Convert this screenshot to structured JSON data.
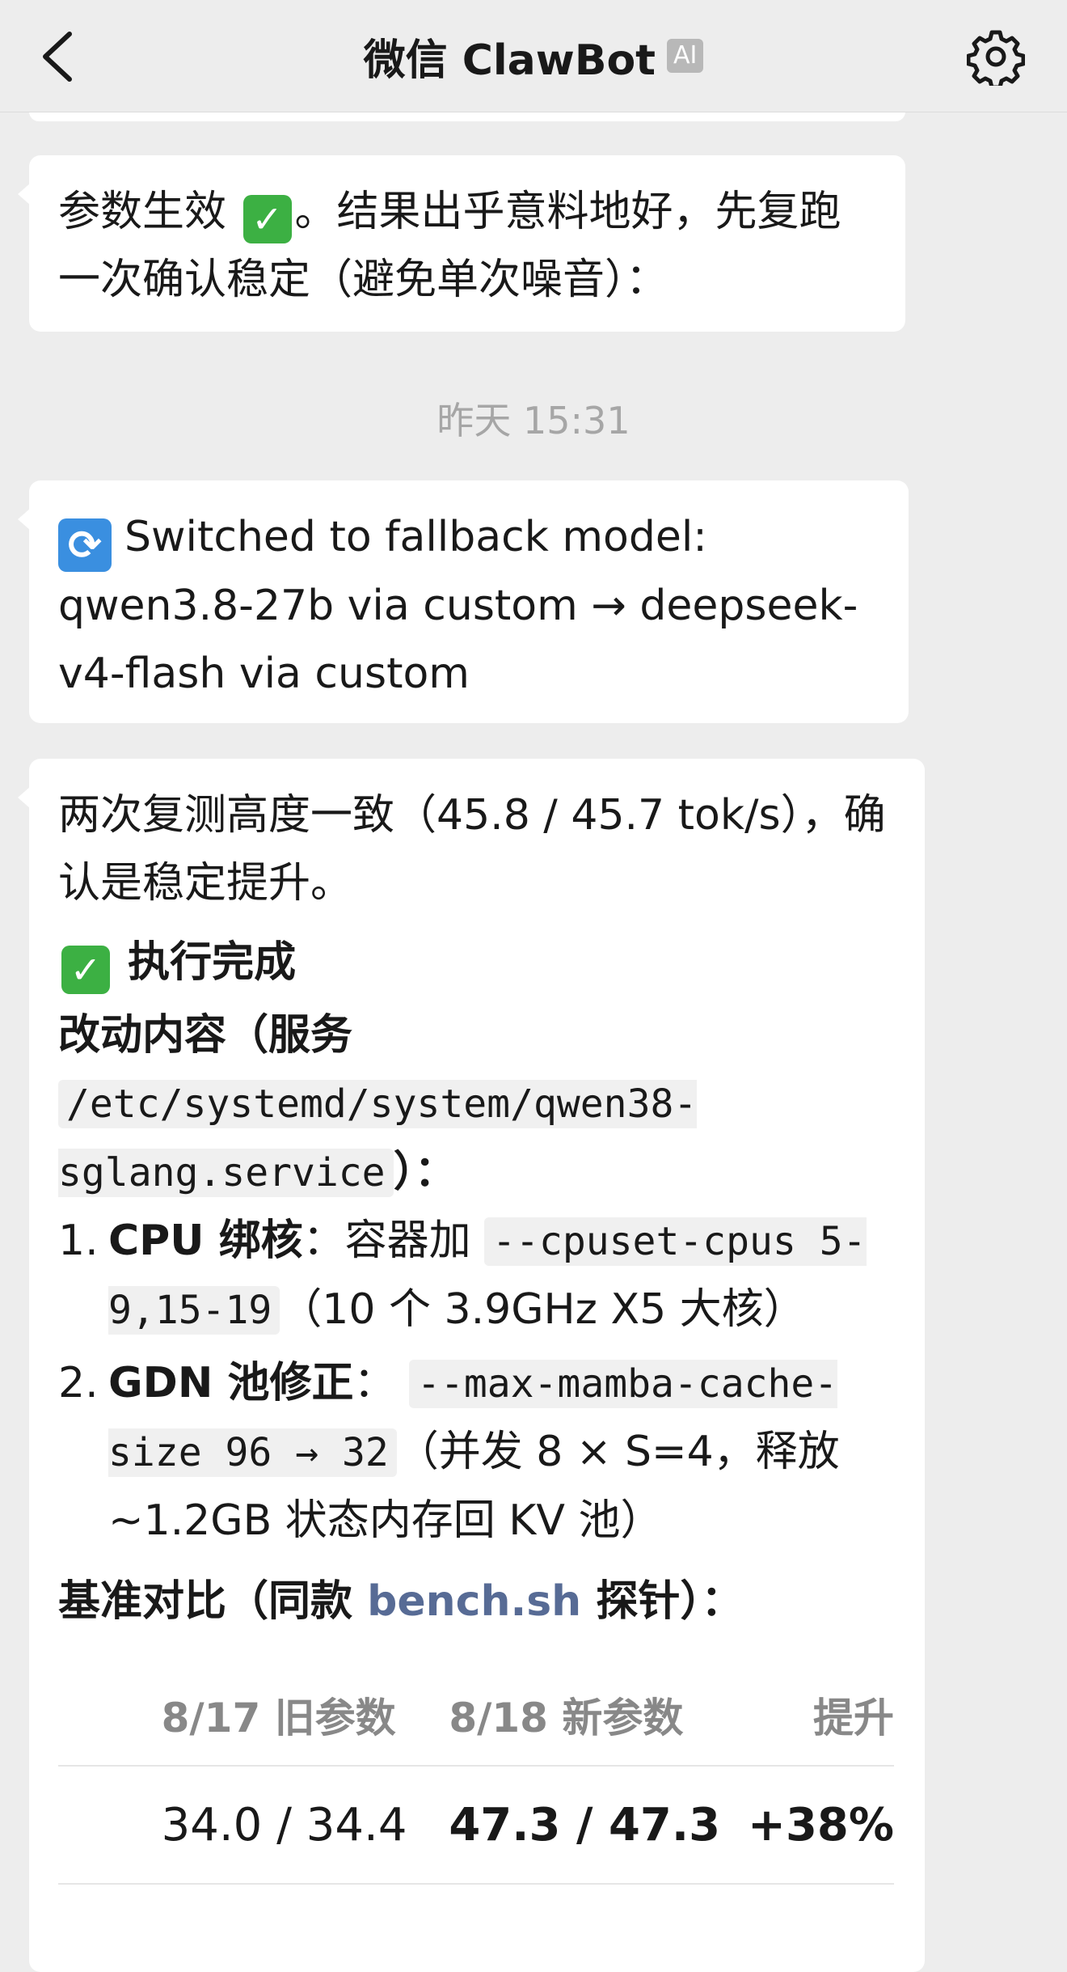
{
  "header": {
    "title": "微信 ClawBot",
    "badge": "AI"
  },
  "messages": {
    "m1": {
      "text_before": "参数生效",
      "text_after": "。结果出乎意料地好，先复跑一次确认稳定（避免单次噪音）："
    },
    "timestamp": "昨天 15:31",
    "m2": {
      "text": "Switched to fallback model: qwen3.8-27b via custom → deepseek-v4-flash via custom"
    },
    "m3": {
      "intro": "两次复测高度一致（45.8 / 45.7 tok/s），确认是稳定提升。",
      "done_heading": "执行完成",
      "changes_label": "改动内容（服务",
      "service_path": "/etc/systemd/system/qwen38-sglang.service",
      "changes_end": "）：",
      "items": [
        {
          "num": "1.",
          "title": "CPU 绑核",
          "mid": "：容器加",
          "code": "--cpuset-cpus 5-9,15-19",
          "tail": "（10 个 3.9GHz X5 大核）"
        },
        {
          "num": "2.",
          "title": "GDN 池修正",
          "mid": "：",
          "code": "--max-mamba-cache-size 96 → 32",
          "tail": "（并发 8 × S=4，释放 ~1.2GB 状态内存回 KV 池）"
        }
      ],
      "bench_label_before": "基准对比（同款",
      "bench_link": "bench.sh",
      "bench_label_after": "探针）：",
      "table": {
        "headers": [
          "",
          "8/17 旧参数",
          "8/18 新参数",
          "提升"
        ],
        "row": [
          "",
          "34.0 / 34.4",
          "47.3 / 47.3",
          "+38%"
        ]
      }
    }
  },
  "colors": {
    "background": "#ededed",
    "bubble": "#ffffff",
    "link": "#576b95",
    "check": "#3cb043"
  },
  "icons": [
    "back-arrow-icon",
    "settings-gear-icon",
    "check-mark-icon",
    "refresh-icon"
  ]
}
